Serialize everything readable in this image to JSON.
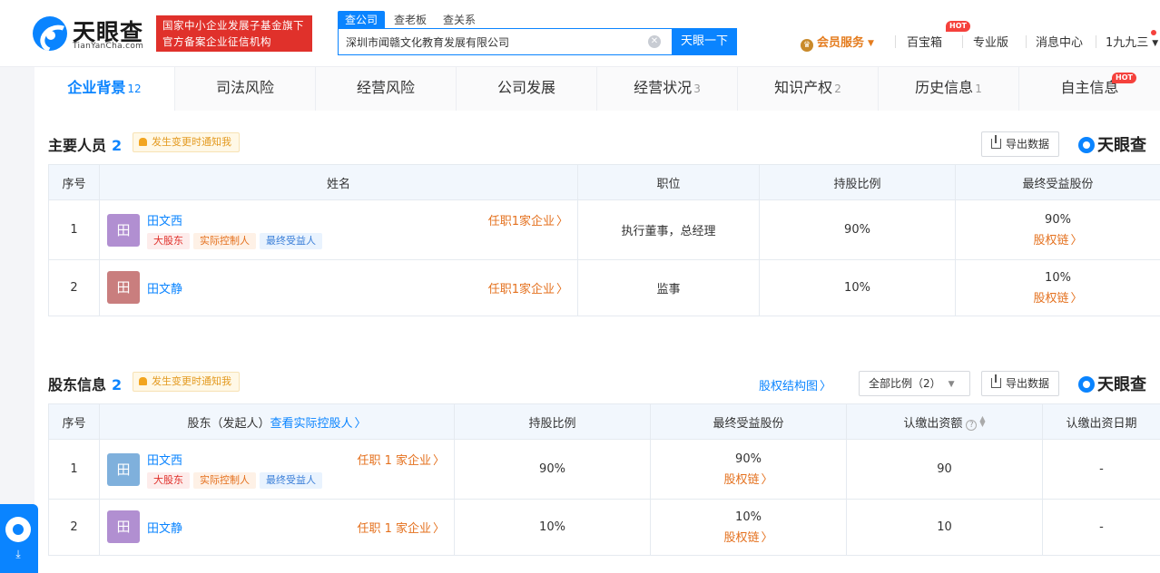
{
  "header": {
    "logo_text": "天眼查",
    "logo_sub": "TianYanCha.com",
    "gov_badge_line1": "国家中小企业发展子基金旗下",
    "gov_badge_line2": "官方备案企业征信机构",
    "search_tabs": [
      "查公司",
      "查老板",
      "查关系"
    ],
    "search_value": "深圳市闻赣文化教育发展有限公司",
    "search_button": "天眼一下",
    "nav": {
      "member": "会员服务",
      "baobao": "百宝箱",
      "hot": "HOT",
      "pro": "专业版",
      "messages": "消息中心",
      "user": "1九九三"
    }
  },
  "tabs": [
    {
      "label": "企业背景",
      "count": "12"
    },
    {
      "label": "司法风险",
      "count": ""
    },
    {
      "label": "经营风险",
      "count": ""
    },
    {
      "label": "公司发展",
      "count": ""
    },
    {
      "label": "经营状况",
      "count": "3"
    },
    {
      "label": "知识产权",
      "count": "2"
    },
    {
      "label": "历史信息",
      "count": "1"
    },
    {
      "label": "自主信息",
      "count": ""
    }
  ],
  "tab_hot": "HOT",
  "personnel": {
    "title": "主要人员",
    "count": "2",
    "notify": "发生变更时通知我",
    "export": "导出数据",
    "brand": "天眼查",
    "headers": [
      "序号",
      "姓名",
      "职位",
      "持股比例",
      "最终受益股份"
    ],
    "rows": [
      {
        "no": "1",
        "avatar": "田",
        "avatar_color": "#b18fd1",
        "name": "田文西",
        "posts": "任职1家企业",
        "tags": [
          "大股东",
          "实际控制人",
          "最终受益人"
        ],
        "position": "执行董事，总经理",
        "ratio": "90%",
        "benefit": "90%",
        "chain": "股权链"
      },
      {
        "no": "2",
        "avatar": "田",
        "avatar_color": "#c97e7e",
        "name": "田文静",
        "posts": "任职1家企业",
        "tags": [],
        "position": "监事",
        "ratio": "10%",
        "benefit": "10%",
        "chain": "股权链"
      }
    ]
  },
  "shareholders": {
    "title": "股东信息",
    "count": "2",
    "notify": "发生变更时通知我",
    "structure_link": "股权结构图",
    "filter": "全部比例（2）",
    "export": "导出数据",
    "brand": "天眼查",
    "headers": [
      "序号",
      "股东（发起人）",
      "查看实际控股人",
      "持股比例",
      "最终受益股份",
      "认缴出资额",
      "认缴出资日期"
    ],
    "rows": [
      {
        "no": "1",
        "avatar": "田",
        "avatar_color": "#7fb0dc",
        "name": "田文西",
        "posts": "任职 1 家企业",
        "tags": [
          "大股东",
          "实际控制人",
          "最终受益人"
        ],
        "ratio": "90%",
        "benefit": "90%",
        "chain": "股权链",
        "amount": "90",
        "date": "-"
      },
      {
        "no": "2",
        "avatar": "田",
        "avatar_color": "#b18fd1",
        "name": "田文静",
        "posts": "任职 1 家企业",
        "tags": [],
        "ratio": "10%",
        "benefit": "10%",
        "chain": "股权链",
        "amount": "10",
        "date": "-"
      }
    ]
  },
  "colors": {
    "primary": "#0a84ff",
    "orange": "#e4701d",
    "red": "#e0312b"
  }
}
